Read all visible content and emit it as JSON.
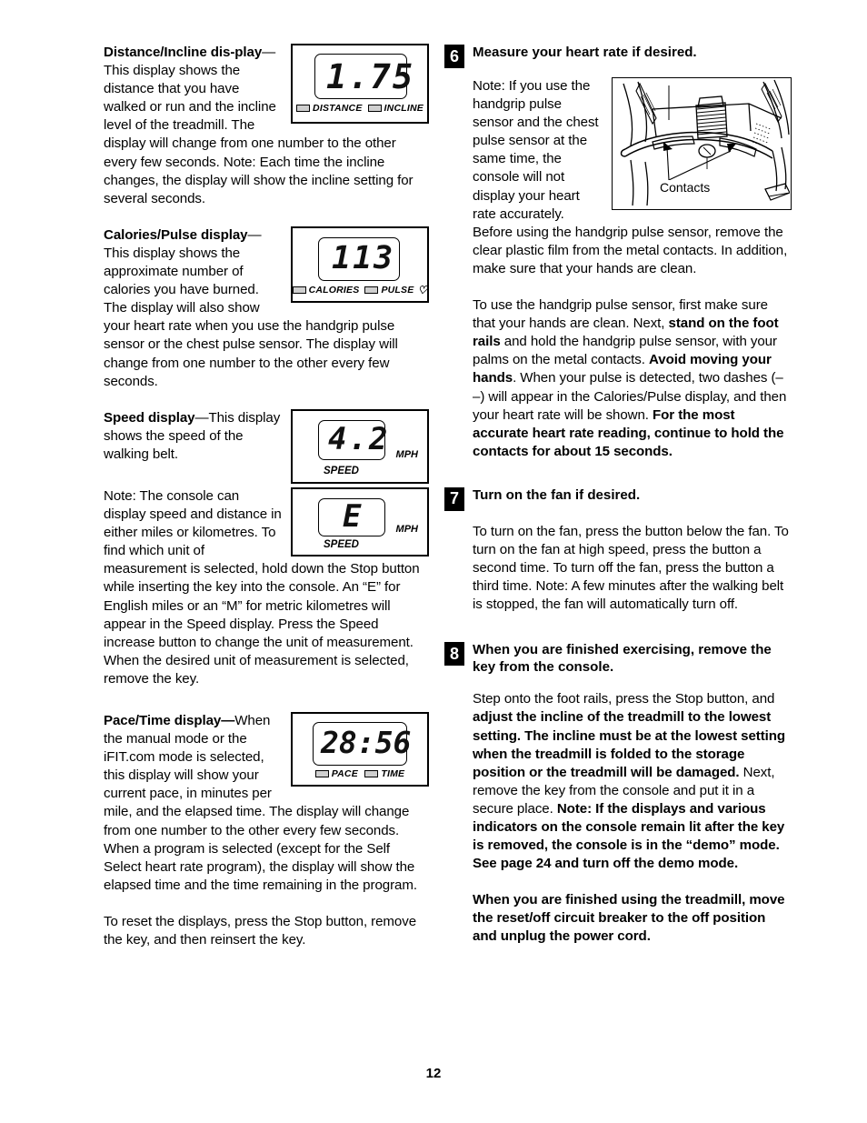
{
  "page": {
    "number": "12"
  },
  "left_column": {
    "sections": [
      {
        "id": "distance-incline",
        "heading": "Distance/Incline dis-play",
        "text": "—This display shows the distance that you have walked or run and the incline level of the treadmill. The display will change from one number to the other every few seconds. Note: Each time the incline changes, the display will show the incline setting for several seconds."
      },
      {
        "id": "calories-pulse",
        "heading": "Calories/Pulse display",
        "text": "—This display shows the approximate number of calories you have burned. The display will also show your heart rate when you use the handgrip pulse sensor or the chest pulse sensor. The display will change from one number to the other every few seconds."
      },
      {
        "id": "speed",
        "heading": "Speed display",
        "text": "—This display shows the speed of the walking belt."
      },
      {
        "id": "units-note",
        "heading": "",
        "text": "Note: The console can display speed and distance in either miles or kilometres. To find which unit of measurement is selected, hold down the Stop button while inserting the key into the console. An “E” for English miles or an “M” for metric kilometres will appear in the Speed display. Press the Speed increase button to change the unit of measurement. When the desired unit of measurement is selected, remove the key."
      },
      {
        "id": "pace-time",
        "heading": "Pace/Time display—",
        "text": "When the manual mode or the iFIT.com mode is selected, this display will show your current pace, in minutes per mile, and the elapsed time. The display will change from one number to the other every few seconds. When a program is selected (except for the Self Select heart rate program), the display will show the elapsed time and the time remaining in the program."
      },
      {
        "id": "reset-note",
        "heading": "",
        "text": "To reset the displays, press the Stop button, remove the key, and then reinsert the key."
      }
    ],
    "figures": {
      "distance_incline": {
        "name": "distance-incline-display",
        "value": "1.75",
        "label_left": "DISTANCE",
        "label_right": "INCLINE"
      },
      "calories_pulse": {
        "name": "calories-pulse-display",
        "value": "113",
        "label_left": "CALORIES",
        "label_right": "PULSE",
        "heart_glyph": "♡"
      },
      "speed": {
        "name": "speed-display",
        "value": "4.2",
        "unit": "MPH",
        "label": "SPEED"
      },
      "speed_units": {
        "name": "speed-units-display",
        "value": "E",
        "unit": "MPH",
        "label": "SPEED"
      },
      "pace_time": {
        "name": "pace-time-display",
        "value": "28:56",
        "label_left": "PACE",
        "label_right": "TIME"
      }
    }
  },
  "right_column": {
    "steps": [
      {
        "number": "6",
        "title": "Measure your heart rate if desired.",
        "body_intro": "Note: If you use the handgrip pulse sensor and the chest pulse sensor at the same time, the console will not display your heart rate accurately. Before using the handgrip pulse sensor, remove the clear plastic film from the metal contacts. In addition, make sure that your hands are clean.",
        "body_second_pre": "To use the handgrip pulse sensor, first make sure that your hands are clean. Next, ",
        "body_second_b1": "stand on the foot rails",
        "body_second_mid1": " and hold the handgrip pulse sensor, with your palms on the metal contacts. ",
        "body_second_b2": "Avoid moving your hands",
        "body_second_mid2": ". When your pulse is detected, two dashes (– –) will appear in the Calories/Pulse display, and then your heart rate will be shown. ",
        "body_second_b3": "For the most accurate heart rate reading, continue to hold the contacts for about 15 seconds.",
        "figure": {
          "name": "handgrip-contacts-illustration",
          "caption": "Contacts"
        }
      },
      {
        "number": "7",
        "title": "Turn on the fan if desired.",
        "body": "To turn on the fan, press the button below the fan. To turn on the fan at high speed, press the button a second time. To turn off the fan, press the button a third time. Note: A few minutes after the walking belt is stopped, the fan will automatically turn off."
      },
      {
        "number": "8",
        "title": "When you are finished exercising, remove the key from the console.",
        "p1_pre": "Step onto the foot rails, press the Stop button, and ",
        "p1_b1": "adjust the incline of the treadmill to the lowest setting. The incline must be at the lowest setting when the treadmill is folded to the storage position or the treadmill will be damaged.",
        "p1_mid": " Next, remove the key from the console and put it in a secure place. ",
        "p1_b2": "Note: If the displays and various indicators on the console remain lit after the key is removed, the console is in the “demo” mode. See page 24 and turn off the demo mode.",
        "p2_b": "When you are finished using the treadmill, move the reset/off circuit breaker to the off position and unplug the power cord."
      }
    ]
  }
}
